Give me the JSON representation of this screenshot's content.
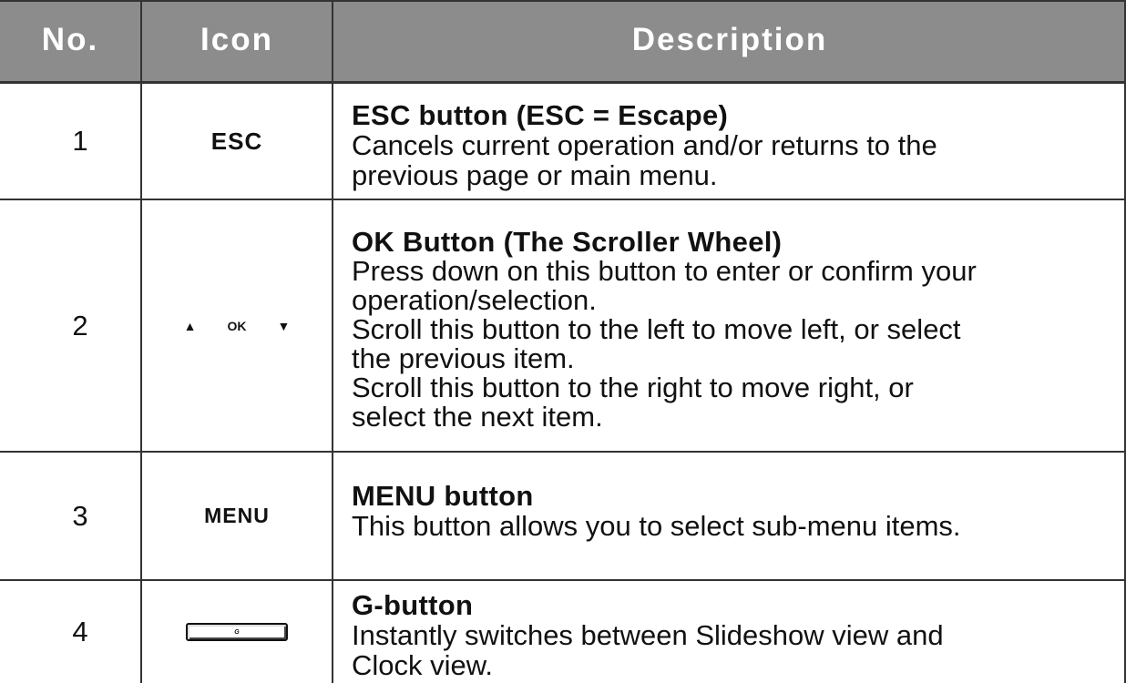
{
  "header": {
    "no": "No.",
    "icon": "Icon",
    "description": "Description"
  },
  "rows": [
    {
      "no": "1",
      "icon_text": "ESC",
      "icon_name": "esc-icon",
      "title": "ESC button (ESC = Escape)",
      "lines": [
        "Cancels current operation and/or returns to the",
        "previous page or main menu."
      ]
    },
    {
      "no": "2",
      "icon_text": "OK",
      "icon_up": "▲",
      "icon_down": "▼",
      "icon_name": "scroller-wheel-icon",
      "title": "OK Button (The Scroller Wheel)",
      "lines": [
        "Press down on this button to enter or confirm your",
        "operation/selection.",
        "Scroll this button to the left to move left, or select",
        "the previous item.",
        "Scroll this button to the right to move right, or",
        "select the next item."
      ]
    },
    {
      "no": "3",
      "icon_text": "MENU",
      "icon_name": "menu-icon",
      "title": "MENU button",
      "lines": [
        "This button allows you to select sub-menu items."
      ]
    },
    {
      "no": "4",
      "icon_text": "G",
      "icon_name": "g-button-icon",
      "title": "G-button",
      "lines": [
        "Instantly switches between Slideshow view and",
        "Clock view."
      ]
    }
  ]
}
